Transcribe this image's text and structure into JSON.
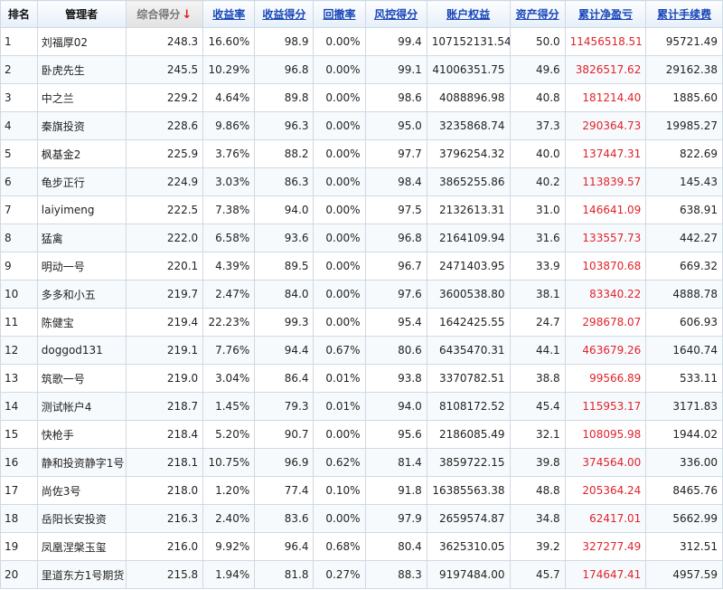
{
  "headers": {
    "rank": "排名",
    "manager": "管理者",
    "composite": "综合得分",
    "composite_arrow": "↓",
    "return_rate": "收益率",
    "return_score": "收益得分",
    "drawdown": "回撤率",
    "risk_score": "风控得分",
    "equity": "账户权益",
    "asset_score": "资产得分",
    "cum_pnl": "累计净盈亏",
    "cum_fee": "累计手续费"
  },
  "colors": {
    "link": "#1846b8",
    "loss_profit": "#e0232a",
    "sort_arrow": "#e02020"
  },
  "rows": [
    {
      "rank": "1",
      "manager": "刘福厚02",
      "composite": "248.3",
      "return_rate": "16.60%",
      "return_score": "98.9",
      "drawdown": "0.00%",
      "risk_score": "99.4",
      "equity": "107152131.54",
      "asset_score": "50.0",
      "cum_pnl": "11456518.51",
      "cum_fee": "95721.49"
    },
    {
      "rank": "2",
      "manager": "卧虎先生",
      "composite": "245.5",
      "return_rate": "10.29%",
      "return_score": "96.8",
      "drawdown": "0.00%",
      "risk_score": "99.1",
      "equity": "41006351.75",
      "asset_score": "49.6",
      "cum_pnl": "3826517.62",
      "cum_fee": "29162.38"
    },
    {
      "rank": "3",
      "manager": "中之兰",
      "composite": "229.2",
      "return_rate": "4.64%",
      "return_score": "89.8",
      "drawdown": "0.00%",
      "risk_score": "98.6",
      "equity": "4088896.98",
      "asset_score": "40.8",
      "cum_pnl": "181214.40",
      "cum_fee": "1885.60"
    },
    {
      "rank": "4",
      "manager": "秦旗投资",
      "composite": "228.6",
      "return_rate": "9.86%",
      "return_score": "96.3",
      "drawdown": "0.00%",
      "risk_score": "95.0",
      "equity": "3235868.74",
      "asset_score": "37.3",
      "cum_pnl": "290364.73",
      "cum_fee": "19985.27"
    },
    {
      "rank": "5",
      "manager": "枫基金2",
      "composite": "225.9",
      "return_rate": "3.76%",
      "return_score": "88.2",
      "drawdown": "0.00%",
      "risk_score": "97.7",
      "equity": "3796254.32",
      "asset_score": "40.0",
      "cum_pnl": "137447.31",
      "cum_fee": "822.69"
    },
    {
      "rank": "6",
      "manager": "龟步正行",
      "composite": "224.9",
      "return_rate": "3.03%",
      "return_score": "86.3",
      "drawdown": "0.00%",
      "risk_score": "98.4",
      "equity": "3865255.86",
      "asset_score": "40.2",
      "cum_pnl": "113839.57",
      "cum_fee": "145.43"
    },
    {
      "rank": "7",
      "manager": "laiyimeng",
      "composite": "222.5",
      "return_rate": "7.38%",
      "return_score": "94.0",
      "drawdown": "0.00%",
      "risk_score": "97.5",
      "equity": "2132613.31",
      "asset_score": "31.0",
      "cum_pnl": "146641.09",
      "cum_fee": "638.91"
    },
    {
      "rank": "8",
      "manager": "猛禽",
      "composite": "222.0",
      "return_rate": "6.58%",
      "return_score": "93.6",
      "drawdown": "0.00%",
      "risk_score": "96.8",
      "equity": "2164109.94",
      "asset_score": "31.6",
      "cum_pnl": "133557.73",
      "cum_fee": "442.27"
    },
    {
      "rank": "9",
      "manager": "明动一号",
      "composite": "220.1",
      "return_rate": "4.39%",
      "return_score": "89.5",
      "drawdown": "0.00%",
      "risk_score": "96.7",
      "equity": "2471403.95",
      "asset_score": "33.9",
      "cum_pnl": "103870.68",
      "cum_fee": "669.32"
    },
    {
      "rank": "10",
      "manager": "多多和小五",
      "composite": "219.7",
      "return_rate": "2.47%",
      "return_score": "84.0",
      "drawdown": "0.00%",
      "risk_score": "97.6",
      "equity": "3600538.80",
      "asset_score": "38.1",
      "cum_pnl": "83340.22",
      "cum_fee": "4888.78"
    },
    {
      "rank": "11",
      "manager": "陈健宝",
      "composite": "219.4",
      "return_rate": "22.23%",
      "return_score": "99.3",
      "drawdown": "0.00%",
      "risk_score": "95.4",
      "equity": "1642425.55",
      "asset_score": "24.7",
      "cum_pnl": "298678.07",
      "cum_fee": "606.93"
    },
    {
      "rank": "12",
      "manager": "doggod131",
      "composite": "219.1",
      "return_rate": "7.76%",
      "return_score": "94.4",
      "drawdown": "0.67%",
      "risk_score": "80.6",
      "equity": "6435470.31",
      "asset_score": "44.1",
      "cum_pnl": "463679.26",
      "cum_fee": "1640.74"
    },
    {
      "rank": "13",
      "manager": "筑歌一号",
      "composite": "219.0",
      "return_rate": "3.04%",
      "return_score": "86.4",
      "drawdown": "0.01%",
      "risk_score": "93.8",
      "equity": "3370782.51",
      "asset_score": "38.8",
      "cum_pnl": "99566.89",
      "cum_fee": "533.11"
    },
    {
      "rank": "14",
      "manager": "测试帐户4",
      "composite": "218.7",
      "return_rate": "1.45%",
      "return_score": "79.3",
      "drawdown": "0.01%",
      "risk_score": "94.0",
      "equity": "8108172.52",
      "asset_score": "45.4",
      "cum_pnl": "115953.17",
      "cum_fee": "3171.83"
    },
    {
      "rank": "15",
      "manager": "快枪手",
      "composite": "218.4",
      "return_rate": "5.20%",
      "return_score": "90.7",
      "drawdown": "0.00%",
      "risk_score": "95.6",
      "equity": "2186085.49",
      "asset_score": "32.1",
      "cum_pnl": "108095.98",
      "cum_fee": "1944.02"
    },
    {
      "rank": "16",
      "manager": "静和投资静字1号",
      "composite": "218.1",
      "return_rate": "10.75%",
      "return_score": "96.9",
      "drawdown": "0.62%",
      "risk_score": "81.4",
      "equity": "3859722.15",
      "asset_score": "39.8",
      "cum_pnl": "374564.00",
      "cum_fee": "336.00"
    },
    {
      "rank": "17",
      "manager": "尚佐3号",
      "composite": "218.0",
      "return_rate": "1.20%",
      "return_score": "77.4",
      "drawdown": "0.10%",
      "risk_score": "91.8",
      "equity": "16385563.38",
      "asset_score": "48.8",
      "cum_pnl": "205364.24",
      "cum_fee": "8465.76"
    },
    {
      "rank": "18",
      "manager": "岳阳长安投资",
      "composite": "216.3",
      "return_rate": "2.40%",
      "return_score": "83.6",
      "drawdown": "0.00%",
      "risk_score": "97.9",
      "equity": "2659574.87",
      "asset_score": "34.8",
      "cum_pnl": "62417.01",
      "cum_fee": "5662.99"
    },
    {
      "rank": "19",
      "manager": "凤凰涅槃玉玺",
      "composite": "216.0",
      "return_rate": "9.92%",
      "return_score": "96.4",
      "drawdown": "0.68%",
      "risk_score": "80.4",
      "equity": "3625310.05",
      "asset_score": "39.2",
      "cum_pnl": "327277.49",
      "cum_fee": "312.51"
    },
    {
      "rank": "20",
      "manager": "里道东方1号期货",
      "composite": "215.8",
      "return_rate": "1.94%",
      "return_score": "81.8",
      "drawdown": "0.27%",
      "risk_score": "88.3",
      "equity": "9197484.00",
      "asset_score": "45.7",
      "cum_pnl": "174647.41",
      "cum_fee": "4957.59"
    }
  ]
}
